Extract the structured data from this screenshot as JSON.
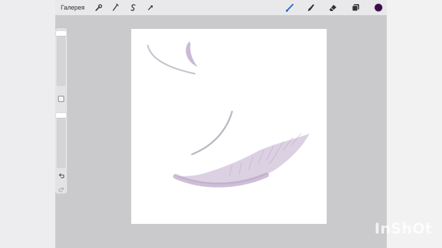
{
  "topbar": {
    "gallery_label": "Галерея",
    "left_tools": [
      {
        "icon": "wrench-icon",
        "name": "actions"
      },
      {
        "icon": "magic-wand-icon",
        "name": "adjustments"
      },
      {
        "icon": "selection-s-icon",
        "name": "selection"
      },
      {
        "icon": "transform-arrow-icon",
        "name": "transform"
      }
    ],
    "right_tools": [
      {
        "icon": "brush-icon",
        "name": "paint",
        "active": true
      },
      {
        "icon": "smudge-icon",
        "name": "smudge"
      },
      {
        "icon": "eraser-icon",
        "name": "erase"
      },
      {
        "icon": "layers-icon",
        "name": "layers"
      }
    ],
    "color": "#3d0b47",
    "accent": "#2f6fd0"
  },
  "sidebar": {
    "brush_size_level": 0.0,
    "opacity_level": 0.0,
    "undo_icon": "undo-icon",
    "redo_icon": "redo-icon"
  },
  "canvas": {
    "stroke_color": "#b9a3c6"
  },
  "watermark": "InShOt"
}
